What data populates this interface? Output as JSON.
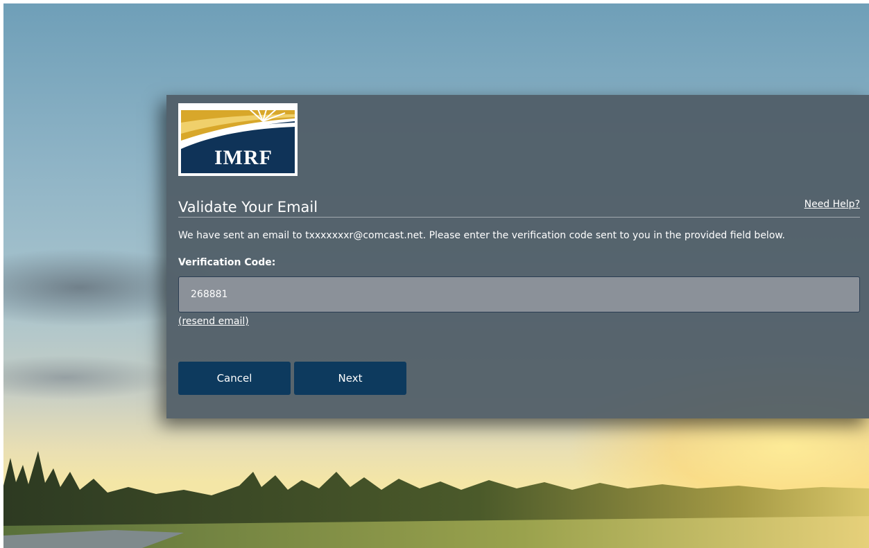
{
  "logo": {
    "text": "IMRF",
    "colors": {
      "gold": "#d8a72a",
      "navy": "#0f3358"
    }
  },
  "heading": {
    "title": "Validate Your Email",
    "help_link": "Need Help?"
  },
  "message": "We have sent an email to txxxxxxxr@comcast.net. Please enter the verification code sent to you in the provided field below.",
  "form": {
    "code_label": "Verification Code:",
    "code_value": "268881",
    "resend_link": "(resend email)"
  },
  "buttons": {
    "cancel": "Cancel",
    "next": "Next"
  },
  "colors": {
    "panel": "#505c66",
    "button": "#0d3a5e",
    "input": "#8b9199"
  }
}
